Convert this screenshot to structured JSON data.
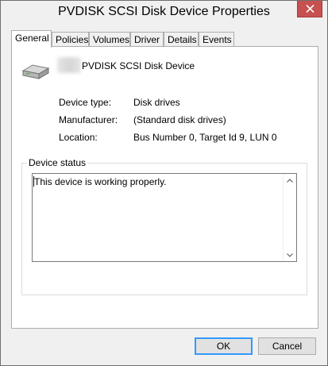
{
  "window": {
    "title": "PVDISK SCSI Disk Device Properties"
  },
  "tabs": [
    {
      "label": "General",
      "active": true
    },
    {
      "label": "Policies"
    },
    {
      "label": "Volumes"
    },
    {
      "label": "Driver"
    },
    {
      "label": "Details"
    },
    {
      "label": "Events"
    }
  ],
  "device": {
    "name": "PVDISK SCSI Disk Device",
    "icon": "disk-drive-icon"
  },
  "properties": {
    "type_label": "Device type:",
    "type_value": "Disk drives",
    "manufacturer_label": "Manufacturer:",
    "manufacturer_value": "(Standard disk drives)",
    "location_label": "Location:",
    "location_value": "Bus Number 0, Target Id 9, LUN 0"
  },
  "status": {
    "legend": "Device status",
    "text": "This device is working properly."
  },
  "buttons": {
    "ok": "OK",
    "cancel": "Cancel"
  },
  "colors": {
    "close_button": "#c75050",
    "default_button_border": "#3399ff"
  }
}
